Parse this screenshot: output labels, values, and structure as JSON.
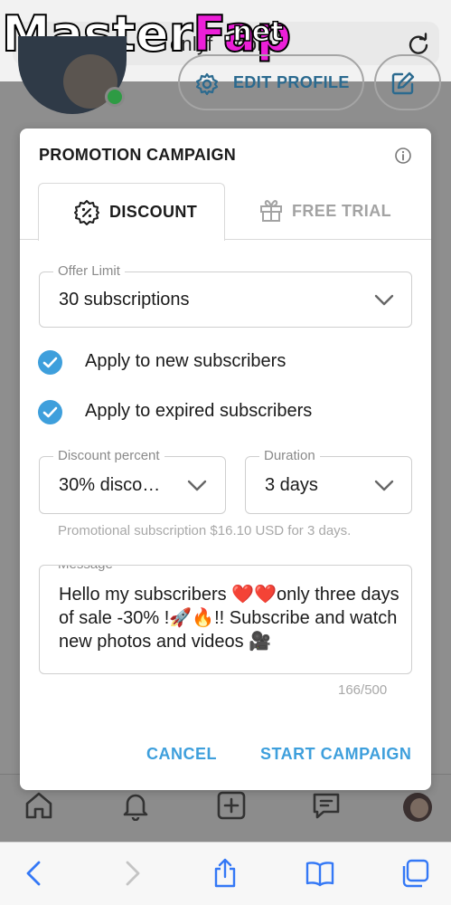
{
  "browser": {
    "url": "onlyfans.com",
    "url_visible": "onlyf   .com",
    "watermark_primary": "Master",
    "watermark_secondary": "Fap",
    "watermark_suffix": ".net"
  },
  "profile": {
    "edit_profile_label": "EDIT PROFILE"
  },
  "modal": {
    "title": "PROMOTION CAMPAIGN",
    "tabs": [
      {
        "label": "DISCOUNT",
        "icon": "discount-badge-icon",
        "active": true
      },
      {
        "label": "FREE TRIAL",
        "icon": "gift-icon",
        "active": false
      }
    ],
    "offer_limit": {
      "legend": "Offer Limit",
      "value": "30 subscriptions"
    },
    "checkboxes": [
      {
        "label": "Apply to new subscribers",
        "checked": true
      },
      {
        "label": "Apply to expired subscribers",
        "checked": true
      }
    ],
    "discount_percent": {
      "legend": "Discount percent",
      "value": "30% disco…"
    },
    "duration": {
      "legend": "Duration",
      "value": "3 days"
    },
    "promo_note": "Promotional subscription $16.10 USD for 3 days.",
    "message": {
      "legend": "Message",
      "value": "Hello my subscribers ❤️❤️only three days of sale -30% !🚀🔥!! Subscribe and watch new photos and videos 🎥",
      "char_count": "166/500"
    },
    "cancel_label": "CANCEL",
    "start_label": "START CAMPAIGN"
  },
  "colors": {
    "accent": "#3e9fdc",
    "overlay": "#8e8e8e",
    "online": "#2e9b44"
  }
}
